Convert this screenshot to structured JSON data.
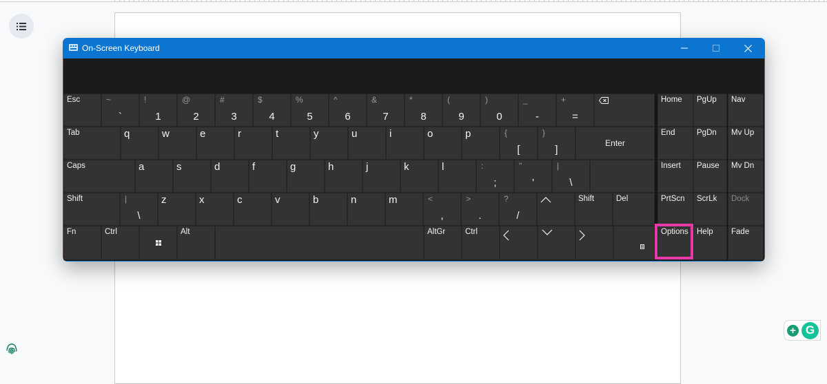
{
  "window": {
    "title": "On-Screen Keyboard"
  },
  "colors": {
    "title_bar": "#0b75cf",
    "key": "#333333",
    "highlight": "#e83aa6"
  },
  "keys": {
    "esc": "Esc",
    "tab": "Tab",
    "caps": "Caps",
    "shift": "Shift",
    "fn": "Fn",
    "ctrl": "Ctrl",
    "alt": "Alt",
    "altgr": "AltGr",
    "enter": "Enter",
    "del": "Del",
    "home": "Home",
    "pgup": "PgUp",
    "nav": "Nav",
    "end": "End",
    "pgdn": "PgDn",
    "mvup": "Mv Up",
    "insert": "Insert",
    "pause": "Pause",
    "mvdn": "Mv Dn",
    "prtscn": "PrtScn",
    "scrlk": "ScrLk",
    "dock": "Dock",
    "options": "Options",
    "help": "Help",
    "fade": "Fade",
    "grave": {
      "shift": "~",
      "main": "`"
    },
    "d1": {
      "shift": "!",
      "main": "1"
    },
    "d2": {
      "shift": "@",
      "main": "2"
    },
    "d3": {
      "shift": "#",
      "main": "3"
    },
    "d4": {
      "shift": "$",
      "main": "4"
    },
    "d5": {
      "shift": "%",
      "main": "5"
    },
    "d6": {
      "shift": "^",
      "main": "6"
    },
    "d7": {
      "shift": "&",
      "main": "7"
    },
    "d8": {
      "shift": "*",
      "main": "8"
    },
    "d9": {
      "shift": "(",
      "main": "9"
    },
    "d0": {
      "shift": ")",
      "main": "0"
    },
    "minus": {
      "shift": "_",
      "main": "-"
    },
    "equal": {
      "shift": "+",
      "main": "="
    },
    "lbracket": {
      "shift": "{",
      "main": "["
    },
    "rbracket": {
      "shift": "}",
      "main": "]"
    },
    "semicolon": {
      "shift": ":",
      "main": ";"
    },
    "quote": {
      "shift": "\"",
      "main": "'"
    },
    "backslash": {
      "shift": "|",
      "main": "\\"
    },
    "intl_backslash": {
      "shift": "|",
      "main": "\\"
    },
    "comma": {
      "shift": "<",
      "main": ","
    },
    "period": {
      "shift": ">",
      "main": "."
    },
    "slash": {
      "shift": "?",
      "main": "/"
    },
    "q": "q",
    "w": "w",
    "e": "e",
    "r": "r",
    "t": "t",
    "y": "y",
    "u": "u",
    "i": "i",
    "o": "o",
    "p": "p",
    "a": "a",
    "s": "s",
    "d": "d",
    "f": "f",
    "g": "g",
    "h": "h",
    "j": "j",
    "k": "k",
    "l": "l",
    "z": "z",
    "x": "x",
    "c": "c",
    "v": "v",
    "b": "b",
    "n": "n",
    "m": "m"
  }
}
